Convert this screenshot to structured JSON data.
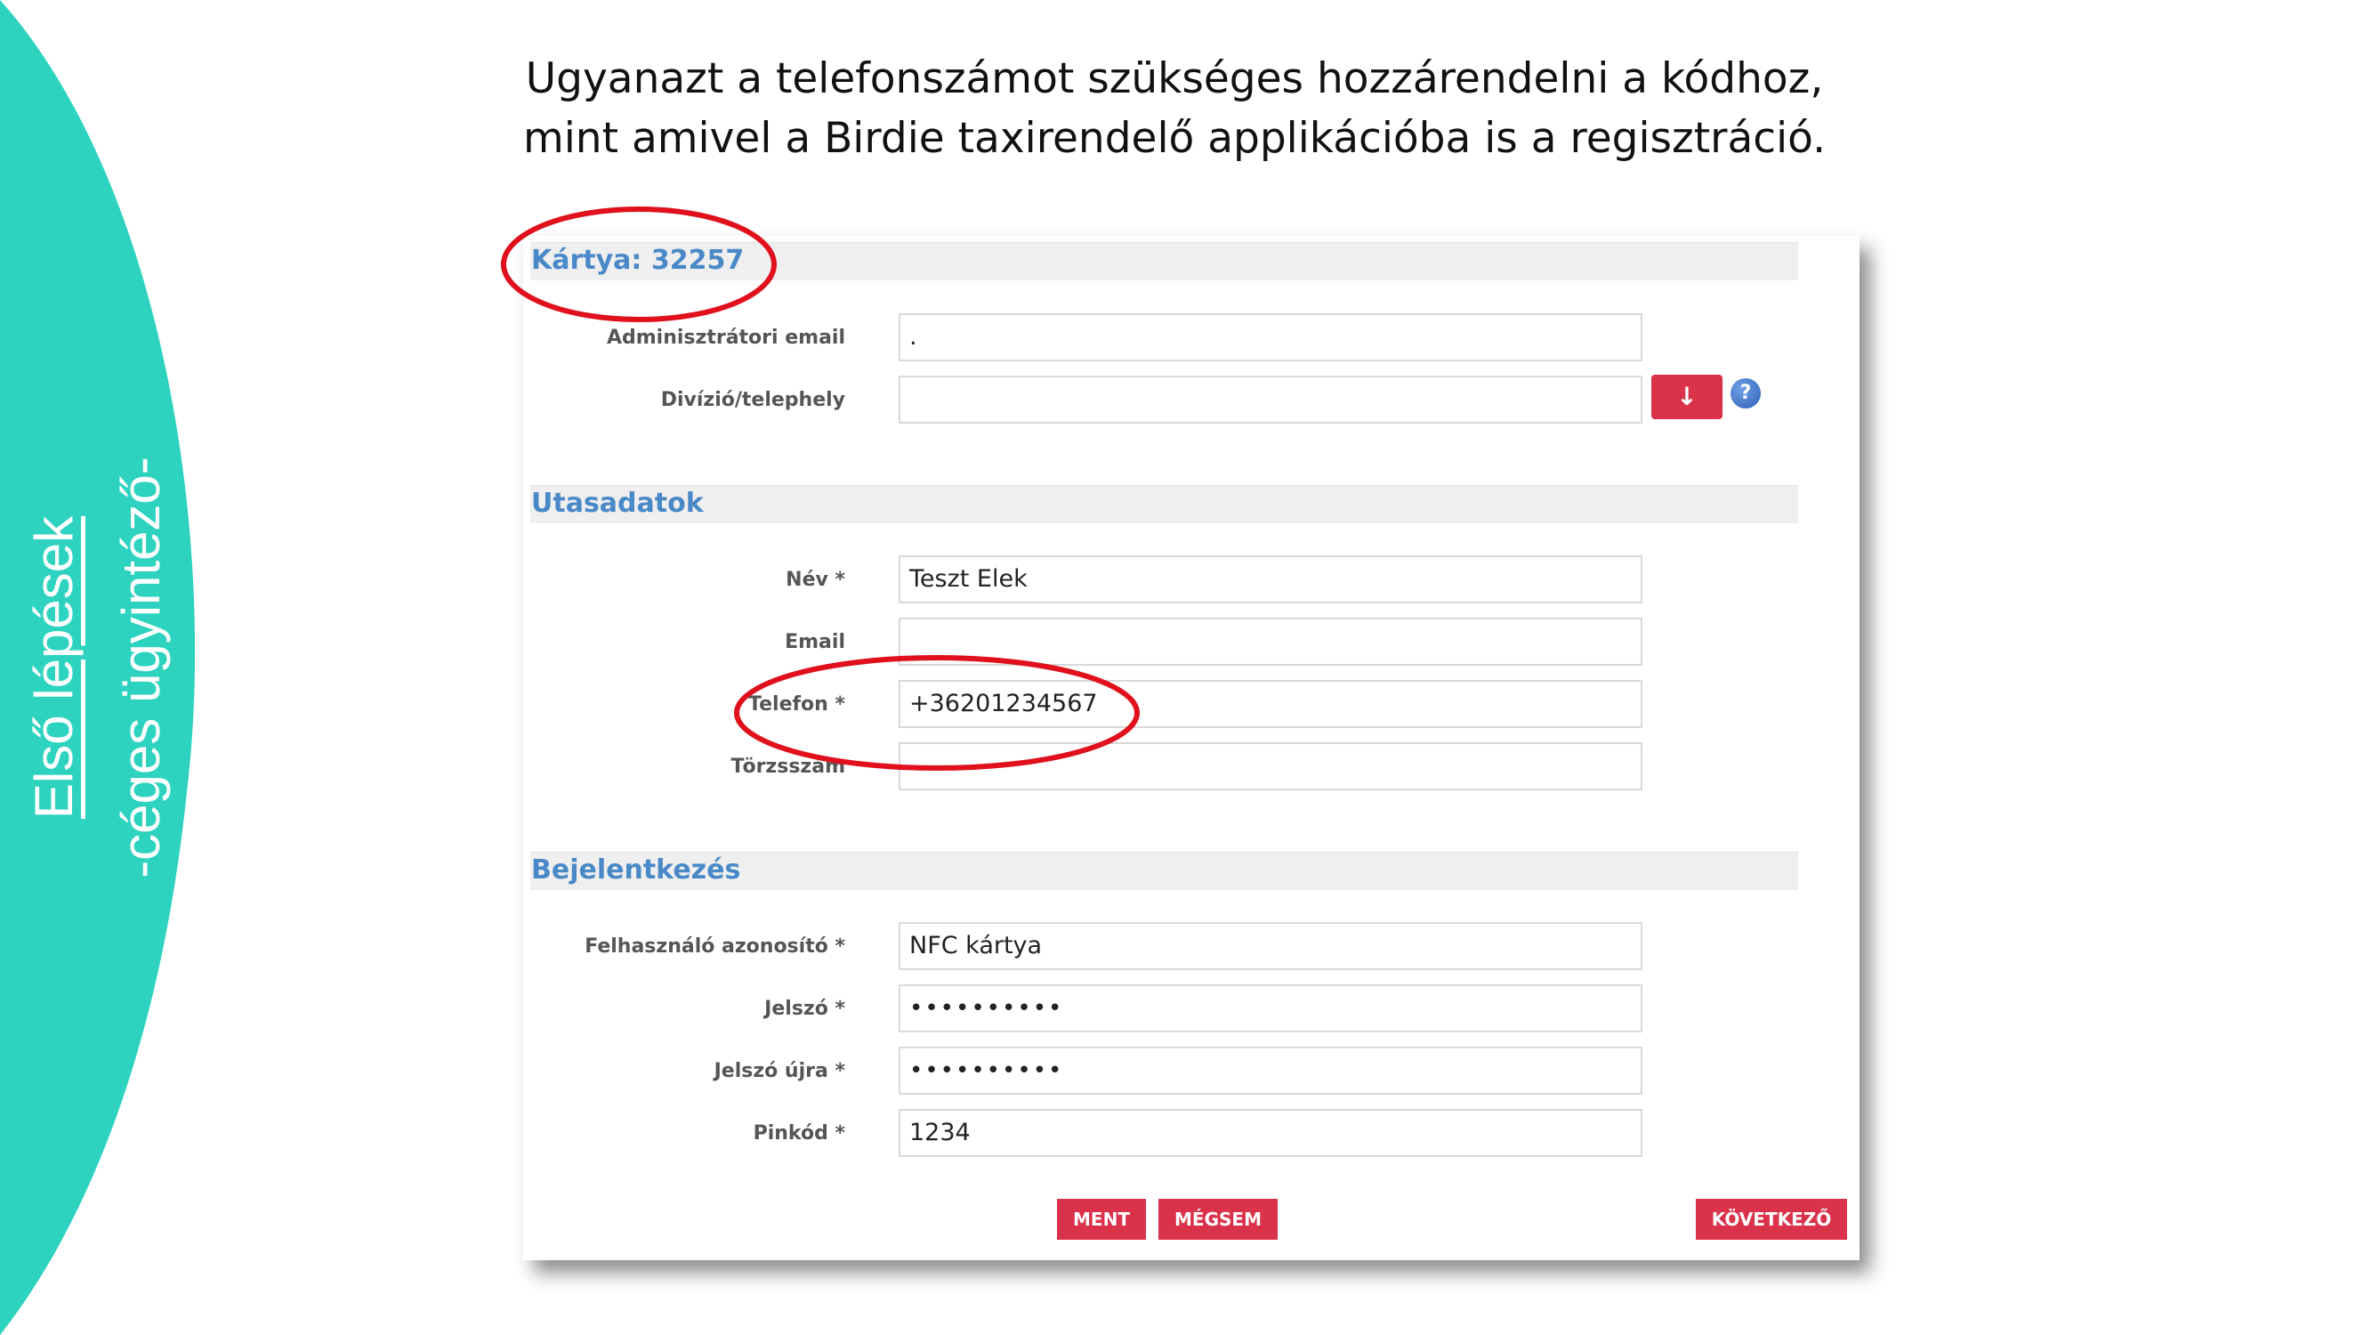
{
  "sidebar": {
    "title_line1": "Első lépések",
    "title_line2": "-céges ügyintéző-",
    "accent_color": "#2dd3bf"
  },
  "heading": {
    "line1": "Ugyanazt a telefonszámot szükséges hozzárendelni a kódhoz,",
    "line2": "mint amivel a Birdie taxirendelő applikációba is a regisztráció."
  },
  "form": {
    "card_title": "Kártya: 32257",
    "admin_email": {
      "label": "Adminisztrátori email",
      "value": "."
    },
    "division": {
      "label": "Divízió/telephely",
      "value": "",
      "dropdown_button": "↓",
      "help_icon": "?"
    },
    "passenger": {
      "title": "Utasadatok",
      "name": {
        "label": "Név *",
        "value": "Teszt Elek"
      },
      "email": {
        "label": "Email",
        "value": ""
      },
      "phone": {
        "label": "Telefon *",
        "value": "+36201234567"
      },
      "employee_id": {
        "label": "Törzsszám",
        "value": ""
      }
    },
    "login": {
      "title": "Bejelentkezés",
      "username": {
        "label": "Felhasználó azonosító *",
        "value": "NFC kártya"
      },
      "password": {
        "label": "Jelszó *",
        "value": "••••••••••"
      },
      "password_again": {
        "label": "Jelszó újra *",
        "value": "••••••••••"
      },
      "pin": {
        "label": "Pinkód *",
        "value": "1234"
      }
    },
    "buttons": {
      "save": "MENT",
      "cancel": "MÉGSEM",
      "next": "KÖVETKEZŐ"
    }
  },
  "highlight_color": "#e0101c"
}
